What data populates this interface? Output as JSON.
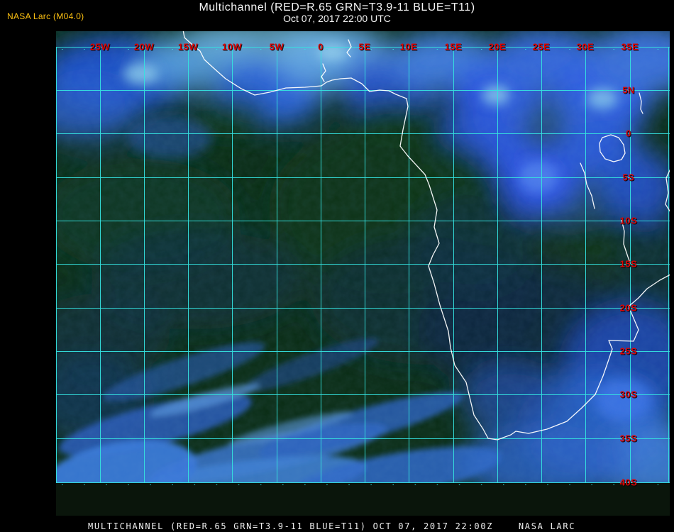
{
  "header": {
    "credit": "NASA Larc (M04.0)",
    "title": "Multichannel (RED=R.65 GRN=T3.9-11 BLUE=T11)",
    "subtitle": "Oct 07, 2017 22:00 UTC"
  },
  "map": {
    "lon_labels": [
      "25W",
      "20W",
      "15W",
      "10W",
      "5W",
      "0",
      "5E",
      "10E",
      "15E",
      "20E",
      "25E",
      "30E",
      "35E"
    ],
    "lat_labels": [
      "5N",
      "0",
      "5S",
      "10S",
      "15S",
      "20S",
      "25S",
      "30S",
      "35S",
      "40S"
    ]
  },
  "footer": {
    "caption": "MULTICHANNEL (RED=R.65 GRN=T3.9-11 BLUE=T11) OCT 07, 2017 22:00Z    NASA LARC"
  },
  "colors": {
    "background": "#000000",
    "grid": "#35e2df",
    "labels": "#dc0606",
    "credit": "#fdc112",
    "title": "#f5f5f5",
    "caption": "#f0f0f0",
    "coastline": "#ffffff"
  }
}
